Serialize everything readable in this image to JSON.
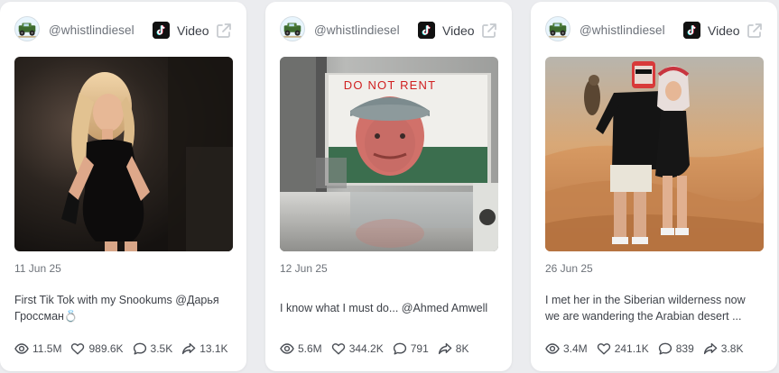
{
  "colors": {
    "page_background": "#ebecef",
    "card_background": "#ffffff",
    "muted_text": "#6c7179",
    "body_text": "#3d4148"
  },
  "cards": [
    {
      "handle": "@whistlindiesel",
      "platform_icon": "tiktok-icon",
      "type_label": "Video",
      "date": "11 Jun 25",
      "caption_lines": [
        "First Tik Tok with my Snookums @Дарья",
        "Гроссман💍"
      ],
      "stats": {
        "views": "11.5M",
        "likes": "989.6K",
        "comments": "3.5K",
        "shares": "13.1K"
      },
      "thumbnail": "woman in black dress dancing in dark room"
    },
    {
      "handle": "@whistlindiesel",
      "platform_icon": "tiktok-icon",
      "type_label": "Video",
      "date": "12 Jun 25",
      "caption_lines": [
        "I know what I must do... @Ahmed Amwell"
      ],
      "stats": {
        "views": "5.6M",
        "likes": "344.2K",
        "comments": "791",
        "shares": "8K"
      },
      "thumbnail": "DO NOT RENT poster of man in cap in garage",
      "thumbnail_text": "DO NOT RENT"
    },
    {
      "handle": "@whistlindiesel",
      "platform_icon": "tiktok-icon",
      "type_label": "Video",
      "date": "26 Jun 25",
      "caption_lines": [
        "I met her in the Siberian wilderness now",
        "we are wandering the Arabian desert ..."
      ],
      "stats": {
        "views": "3.4M",
        "likes": "241.1K",
        "comments": "839",
        "shares": "3.8K"
      },
      "thumbnail": "couple with falcon in desert dunes"
    }
  ]
}
